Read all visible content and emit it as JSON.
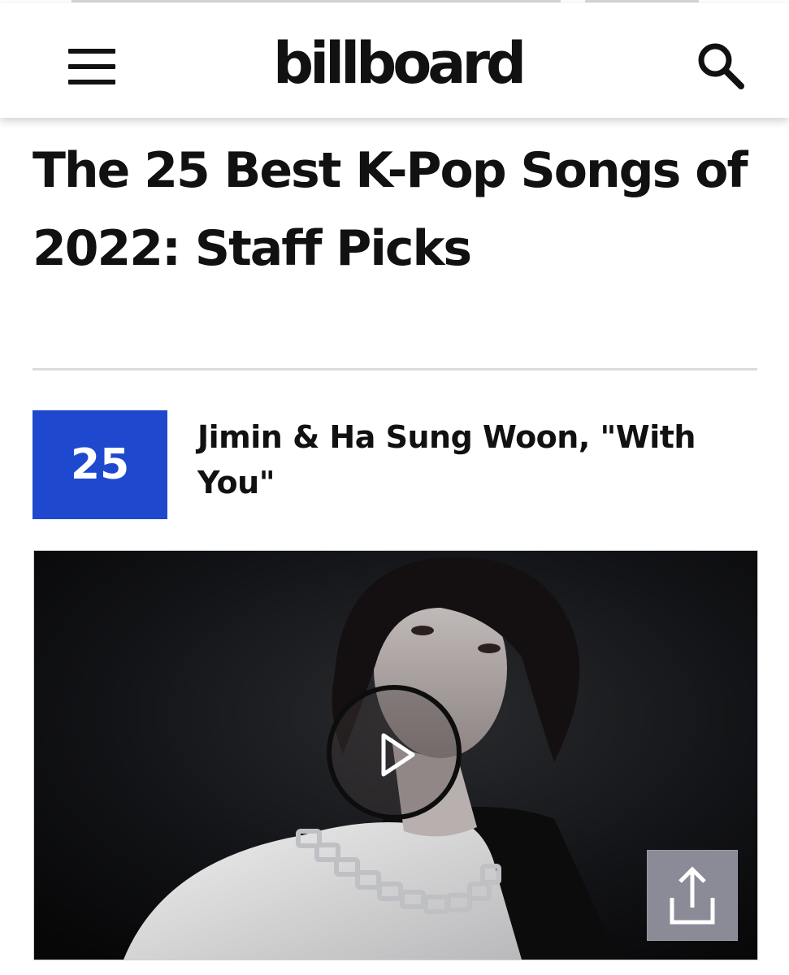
{
  "header": {
    "logo_text": "billboard",
    "menu_icon": "hamburger-menu-icon",
    "search_icon": "search-icon"
  },
  "article": {
    "title": "The 25 Best K-Pop Songs of 2022: Staff Picks"
  },
  "entry": {
    "rank": "25",
    "song_title": "Jimin & Ha Sung Woon, \"With You\""
  },
  "video": {
    "play_icon": "play-icon",
    "share_icon": "share-icon"
  },
  "colors": {
    "rank_box": "#1e49cf",
    "text": "#111111",
    "share_button": "#8b8a97"
  }
}
